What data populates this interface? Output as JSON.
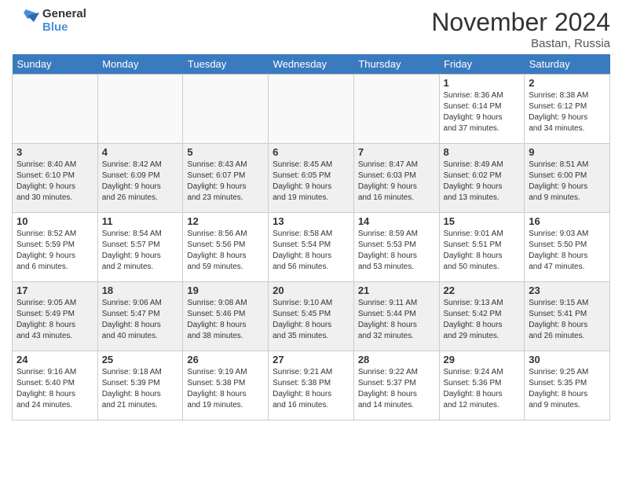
{
  "header": {
    "logo_general": "General",
    "logo_blue": "Blue",
    "title": "November 2024",
    "location": "Bastan, Russia"
  },
  "days_of_week": [
    "Sunday",
    "Monday",
    "Tuesday",
    "Wednesday",
    "Thursday",
    "Friday",
    "Saturday"
  ],
  "weeks": [
    [
      {
        "day": "",
        "info": "",
        "empty": true
      },
      {
        "day": "",
        "info": "",
        "empty": true
      },
      {
        "day": "",
        "info": "",
        "empty": true
      },
      {
        "day": "",
        "info": "",
        "empty": true
      },
      {
        "day": "",
        "info": "",
        "empty": true
      },
      {
        "day": "1",
        "info": "Sunrise: 8:36 AM\nSunset: 6:14 PM\nDaylight: 9 hours\nand 37 minutes.",
        "empty": false
      },
      {
        "day": "2",
        "info": "Sunrise: 8:38 AM\nSunset: 6:12 PM\nDaylight: 9 hours\nand 34 minutes.",
        "empty": false
      }
    ],
    [
      {
        "day": "3",
        "info": "Sunrise: 8:40 AM\nSunset: 6:10 PM\nDaylight: 9 hours\nand 30 minutes.",
        "empty": false
      },
      {
        "day": "4",
        "info": "Sunrise: 8:42 AM\nSunset: 6:09 PM\nDaylight: 9 hours\nand 26 minutes.",
        "empty": false
      },
      {
        "day": "5",
        "info": "Sunrise: 8:43 AM\nSunset: 6:07 PM\nDaylight: 9 hours\nand 23 minutes.",
        "empty": false
      },
      {
        "day": "6",
        "info": "Sunrise: 8:45 AM\nSunset: 6:05 PM\nDaylight: 9 hours\nand 19 minutes.",
        "empty": false
      },
      {
        "day": "7",
        "info": "Sunrise: 8:47 AM\nSunset: 6:03 PM\nDaylight: 9 hours\nand 16 minutes.",
        "empty": false
      },
      {
        "day": "8",
        "info": "Sunrise: 8:49 AM\nSunset: 6:02 PM\nDaylight: 9 hours\nand 13 minutes.",
        "empty": false
      },
      {
        "day": "9",
        "info": "Sunrise: 8:51 AM\nSunset: 6:00 PM\nDaylight: 9 hours\nand 9 minutes.",
        "empty": false
      }
    ],
    [
      {
        "day": "10",
        "info": "Sunrise: 8:52 AM\nSunset: 5:59 PM\nDaylight: 9 hours\nand 6 minutes.",
        "empty": false
      },
      {
        "day": "11",
        "info": "Sunrise: 8:54 AM\nSunset: 5:57 PM\nDaylight: 9 hours\nand 2 minutes.",
        "empty": false
      },
      {
        "day": "12",
        "info": "Sunrise: 8:56 AM\nSunset: 5:56 PM\nDaylight: 8 hours\nand 59 minutes.",
        "empty": false
      },
      {
        "day": "13",
        "info": "Sunrise: 8:58 AM\nSunset: 5:54 PM\nDaylight: 8 hours\nand 56 minutes.",
        "empty": false
      },
      {
        "day": "14",
        "info": "Sunrise: 8:59 AM\nSunset: 5:53 PM\nDaylight: 8 hours\nand 53 minutes.",
        "empty": false
      },
      {
        "day": "15",
        "info": "Sunrise: 9:01 AM\nSunset: 5:51 PM\nDaylight: 8 hours\nand 50 minutes.",
        "empty": false
      },
      {
        "day": "16",
        "info": "Sunrise: 9:03 AM\nSunset: 5:50 PM\nDaylight: 8 hours\nand 47 minutes.",
        "empty": false
      }
    ],
    [
      {
        "day": "17",
        "info": "Sunrise: 9:05 AM\nSunset: 5:49 PM\nDaylight: 8 hours\nand 43 minutes.",
        "empty": false
      },
      {
        "day": "18",
        "info": "Sunrise: 9:06 AM\nSunset: 5:47 PM\nDaylight: 8 hours\nand 40 minutes.",
        "empty": false
      },
      {
        "day": "19",
        "info": "Sunrise: 9:08 AM\nSunset: 5:46 PM\nDaylight: 8 hours\nand 38 minutes.",
        "empty": false
      },
      {
        "day": "20",
        "info": "Sunrise: 9:10 AM\nSunset: 5:45 PM\nDaylight: 8 hours\nand 35 minutes.",
        "empty": false
      },
      {
        "day": "21",
        "info": "Sunrise: 9:11 AM\nSunset: 5:44 PM\nDaylight: 8 hours\nand 32 minutes.",
        "empty": false
      },
      {
        "day": "22",
        "info": "Sunrise: 9:13 AM\nSunset: 5:42 PM\nDaylight: 8 hours\nand 29 minutes.",
        "empty": false
      },
      {
        "day": "23",
        "info": "Sunrise: 9:15 AM\nSunset: 5:41 PM\nDaylight: 8 hours\nand 26 minutes.",
        "empty": false
      }
    ],
    [
      {
        "day": "24",
        "info": "Sunrise: 9:16 AM\nSunset: 5:40 PM\nDaylight: 8 hours\nand 24 minutes.",
        "empty": false
      },
      {
        "day": "25",
        "info": "Sunrise: 9:18 AM\nSunset: 5:39 PM\nDaylight: 8 hours\nand 21 minutes.",
        "empty": false
      },
      {
        "day": "26",
        "info": "Sunrise: 9:19 AM\nSunset: 5:38 PM\nDaylight: 8 hours\nand 19 minutes.",
        "empty": false
      },
      {
        "day": "27",
        "info": "Sunrise: 9:21 AM\nSunset: 5:38 PM\nDaylight: 8 hours\nand 16 minutes.",
        "empty": false
      },
      {
        "day": "28",
        "info": "Sunrise: 9:22 AM\nSunset: 5:37 PM\nDaylight: 8 hours\nand 14 minutes.",
        "empty": false
      },
      {
        "day": "29",
        "info": "Sunrise: 9:24 AM\nSunset: 5:36 PM\nDaylight: 8 hours\nand 12 minutes.",
        "empty": false
      },
      {
        "day": "30",
        "info": "Sunrise: 9:25 AM\nSunset: 5:35 PM\nDaylight: 8 hours\nand 9 minutes.",
        "empty": false
      }
    ]
  ]
}
